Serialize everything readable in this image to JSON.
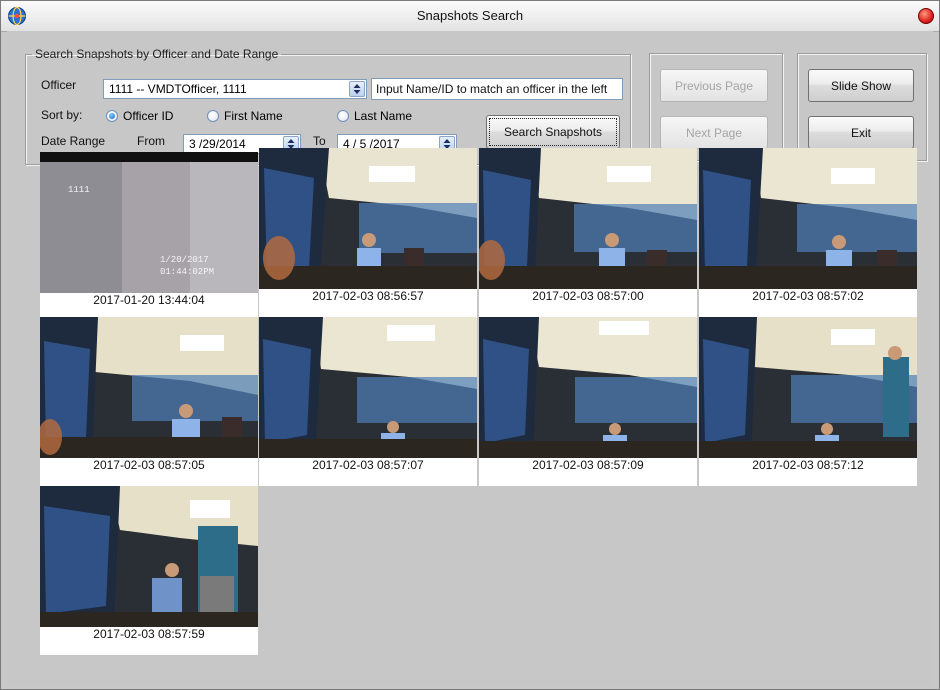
{
  "window": {
    "title": "Snapshots Search"
  },
  "search_group": {
    "legend": "Search Snapshots by Officer and Date Range",
    "officer_label": "Officer",
    "officer_value": "1111 -- VMDTOfficer, 1111",
    "officer_hint_input_value": "Input Name/ID to match an officer in the left",
    "sort_by_label": "Sort by:",
    "sort_options": [
      {
        "label": "Officer ID",
        "checked": true
      },
      {
        "label": "First Name",
        "checked": false
      },
      {
        "label": "Last Name",
        "checked": false
      }
    ],
    "date_range_label": "Date Range",
    "from_label": "From",
    "from_value": "3 /29/2014",
    "to_label": "To",
    "to_value": "4 / 5 /2017",
    "search_button": "Search Snapshots"
  },
  "paging": {
    "previous_button": "Previous Page",
    "next_button": "Next Page"
  },
  "actions": {
    "slideshow_button": "Slide Show",
    "exit_button": "Exit"
  },
  "snapshots": [
    {
      "timestamp": "2017-01-20  13:44:04",
      "overlay": [
        "1111",
        "1/20/2017",
        "01:44:02PM"
      ]
    },
    {
      "timestamp": "2017-02-03  08:56:57"
    },
    {
      "timestamp": "2017-02-03  08:57:00"
    },
    {
      "timestamp": "2017-02-03  08:57:02"
    },
    {
      "timestamp": "2017-02-03  08:57:05"
    },
    {
      "timestamp": "2017-02-03  08:57:07"
    },
    {
      "timestamp": "2017-02-03  08:57:09"
    },
    {
      "timestamp": "2017-02-03  08:57:12"
    },
    {
      "timestamp": "2017-02-03  08:57:59"
    }
  ],
  "icons": {
    "app": "app-globe-icon",
    "close": "close-icon",
    "spinner": "spin-arrows-icon"
  }
}
